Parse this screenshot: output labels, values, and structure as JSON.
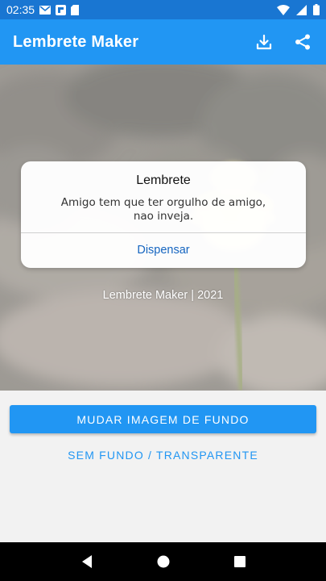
{
  "status_bar": {
    "time": "02:35",
    "icons": [
      "gmail-icon",
      "flipboard-icon",
      "sd-card-icon",
      "wifi-icon",
      "signal-icon",
      "battery-icon"
    ]
  },
  "app_bar": {
    "title": "Lembrete Maker",
    "actions": [
      "download-icon",
      "share-icon"
    ],
    "color": "#2196f3"
  },
  "preview": {
    "background": "blurred-flower-photo",
    "footer": "Lembrete Maker | 2021"
  },
  "dialog": {
    "title": "Lembrete",
    "message_line1": "Amigo tem que ter orgulho de amigo,",
    "message_line2": "nao inveja.",
    "button": "Dispensar"
  },
  "buttons": {
    "change_background": "MUDAR IMAGEM DE FUNDO",
    "no_background": "SEM FUNDO / TRANSPARENTE"
  },
  "nav_bar": {
    "buttons": [
      "back-icon",
      "home-icon",
      "recents-icon"
    ]
  },
  "colors": {
    "primary": "#2196f3",
    "primary_dark": "#1976d2",
    "dialog_button": "#1565c0"
  }
}
